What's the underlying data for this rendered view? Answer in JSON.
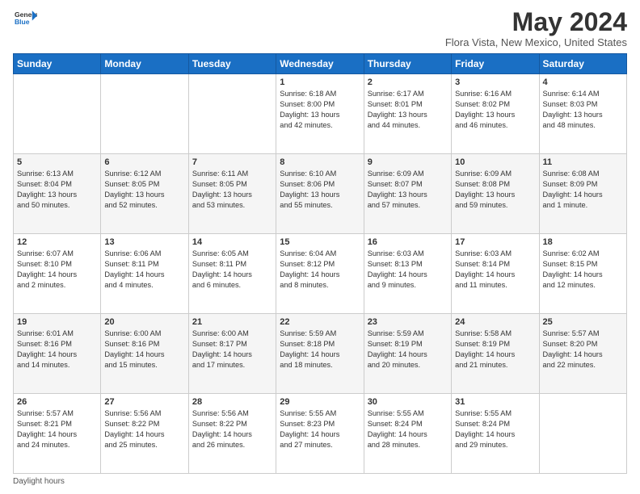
{
  "header": {
    "logo_general": "General",
    "logo_blue": "Blue",
    "month_title": "May 2024",
    "location": "Flora Vista, New Mexico, United States"
  },
  "days_of_week": [
    "Sunday",
    "Monday",
    "Tuesday",
    "Wednesday",
    "Thursday",
    "Friday",
    "Saturday"
  ],
  "footer": {
    "daylight_label": "Daylight hours"
  },
  "weeks": [
    [
      {
        "day": "",
        "info": ""
      },
      {
        "day": "",
        "info": ""
      },
      {
        "day": "",
        "info": ""
      },
      {
        "day": "1",
        "info": "Sunrise: 6:18 AM\nSunset: 8:00 PM\nDaylight: 13 hours\nand 42 minutes."
      },
      {
        "day": "2",
        "info": "Sunrise: 6:17 AM\nSunset: 8:01 PM\nDaylight: 13 hours\nand 44 minutes."
      },
      {
        "day": "3",
        "info": "Sunrise: 6:16 AM\nSunset: 8:02 PM\nDaylight: 13 hours\nand 46 minutes."
      },
      {
        "day": "4",
        "info": "Sunrise: 6:14 AM\nSunset: 8:03 PM\nDaylight: 13 hours\nand 48 minutes."
      }
    ],
    [
      {
        "day": "5",
        "info": "Sunrise: 6:13 AM\nSunset: 8:04 PM\nDaylight: 13 hours\nand 50 minutes."
      },
      {
        "day": "6",
        "info": "Sunrise: 6:12 AM\nSunset: 8:05 PM\nDaylight: 13 hours\nand 52 minutes."
      },
      {
        "day": "7",
        "info": "Sunrise: 6:11 AM\nSunset: 8:05 PM\nDaylight: 13 hours\nand 53 minutes."
      },
      {
        "day": "8",
        "info": "Sunrise: 6:10 AM\nSunset: 8:06 PM\nDaylight: 13 hours\nand 55 minutes."
      },
      {
        "day": "9",
        "info": "Sunrise: 6:09 AM\nSunset: 8:07 PM\nDaylight: 13 hours\nand 57 minutes."
      },
      {
        "day": "10",
        "info": "Sunrise: 6:09 AM\nSunset: 8:08 PM\nDaylight: 13 hours\nand 59 minutes."
      },
      {
        "day": "11",
        "info": "Sunrise: 6:08 AM\nSunset: 8:09 PM\nDaylight: 14 hours\nand 1 minute."
      }
    ],
    [
      {
        "day": "12",
        "info": "Sunrise: 6:07 AM\nSunset: 8:10 PM\nDaylight: 14 hours\nand 2 minutes."
      },
      {
        "day": "13",
        "info": "Sunrise: 6:06 AM\nSunset: 8:11 PM\nDaylight: 14 hours\nand 4 minutes."
      },
      {
        "day": "14",
        "info": "Sunrise: 6:05 AM\nSunset: 8:11 PM\nDaylight: 14 hours\nand 6 minutes."
      },
      {
        "day": "15",
        "info": "Sunrise: 6:04 AM\nSunset: 8:12 PM\nDaylight: 14 hours\nand 8 minutes."
      },
      {
        "day": "16",
        "info": "Sunrise: 6:03 AM\nSunset: 8:13 PM\nDaylight: 14 hours\nand 9 minutes."
      },
      {
        "day": "17",
        "info": "Sunrise: 6:03 AM\nSunset: 8:14 PM\nDaylight: 14 hours\nand 11 minutes."
      },
      {
        "day": "18",
        "info": "Sunrise: 6:02 AM\nSunset: 8:15 PM\nDaylight: 14 hours\nand 12 minutes."
      }
    ],
    [
      {
        "day": "19",
        "info": "Sunrise: 6:01 AM\nSunset: 8:16 PM\nDaylight: 14 hours\nand 14 minutes."
      },
      {
        "day": "20",
        "info": "Sunrise: 6:00 AM\nSunset: 8:16 PM\nDaylight: 14 hours\nand 15 minutes."
      },
      {
        "day": "21",
        "info": "Sunrise: 6:00 AM\nSunset: 8:17 PM\nDaylight: 14 hours\nand 17 minutes."
      },
      {
        "day": "22",
        "info": "Sunrise: 5:59 AM\nSunset: 8:18 PM\nDaylight: 14 hours\nand 18 minutes."
      },
      {
        "day": "23",
        "info": "Sunrise: 5:59 AM\nSunset: 8:19 PM\nDaylight: 14 hours\nand 20 minutes."
      },
      {
        "day": "24",
        "info": "Sunrise: 5:58 AM\nSunset: 8:19 PM\nDaylight: 14 hours\nand 21 minutes."
      },
      {
        "day": "25",
        "info": "Sunrise: 5:57 AM\nSunset: 8:20 PM\nDaylight: 14 hours\nand 22 minutes."
      }
    ],
    [
      {
        "day": "26",
        "info": "Sunrise: 5:57 AM\nSunset: 8:21 PM\nDaylight: 14 hours\nand 24 minutes."
      },
      {
        "day": "27",
        "info": "Sunrise: 5:56 AM\nSunset: 8:22 PM\nDaylight: 14 hours\nand 25 minutes."
      },
      {
        "day": "28",
        "info": "Sunrise: 5:56 AM\nSunset: 8:22 PM\nDaylight: 14 hours\nand 26 minutes."
      },
      {
        "day": "29",
        "info": "Sunrise: 5:55 AM\nSunset: 8:23 PM\nDaylight: 14 hours\nand 27 minutes."
      },
      {
        "day": "30",
        "info": "Sunrise: 5:55 AM\nSunset: 8:24 PM\nDaylight: 14 hours\nand 28 minutes."
      },
      {
        "day": "31",
        "info": "Sunrise: 5:55 AM\nSunset: 8:24 PM\nDaylight: 14 hours\nand 29 minutes."
      },
      {
        "day": "",
        "info": ""
      }
    ]
  ]
}
